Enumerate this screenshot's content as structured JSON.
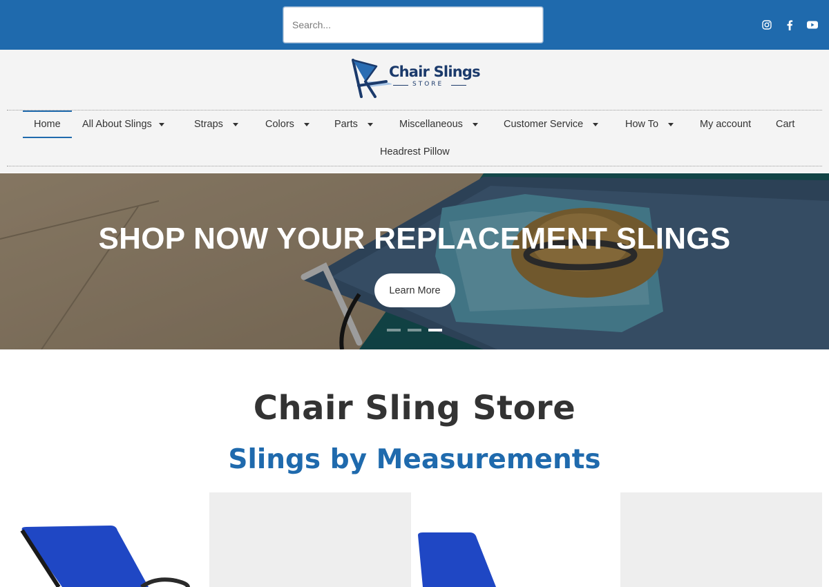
{
  "search": {
    "placeholder": "Search..."
  },
  "social": [
    {
      "icon": "instagram-icon"
    },
    {
      "icon": "facebook-icon"
    },
    {
      "icon": "youtube-icon"
    }
  ],
  "logo": {
    "name": "Chair Slings",
    "sub": "STORE"
  },
  "nav": {
    "items": [
      {
        "label": "Home",
        "dropdown": false,
        "active": true
      },
      {
        "label": "All About Slings",
        "dropdown": true
      },
      {
        "label": "Straps",
        "dropdown": true
      },
      {
        "label": "Colors",
        "dropdown": true
      },
      {
        "label": "Parts",
        "dropdown": true
      },
      {
        "label": "Miscellaneous",
        "dropdown": true
      },
      {
        "label": "Customer Service",
        "dropdown": true
      },
      {
        "label": "How To",
        "dropdown": true
      },
      {
        "label": "My account",
        "dropdown": false
      },
      {
        "label": "Cart",
        "dropdown": false
      },
      {
        "label": "Headrest Pillow",
        "dropdown": false
      }
    ]
  },
  "hero": {
    "title": "SHOP NOW YOUR REPLACEMENT SLINGS",
    "button": "Learn More",
    "slides": 3,
    "active_slide": 3
  },
  "main": {
    "title": "Chair Sling Store",
    "subtitle": "Slings by Measurements"
  },
  "colors": {
    "topbar": "#1f6aad",
    "accent": "#1f6aad",
    "sling_blue": "#1f47c4"
  }
}
